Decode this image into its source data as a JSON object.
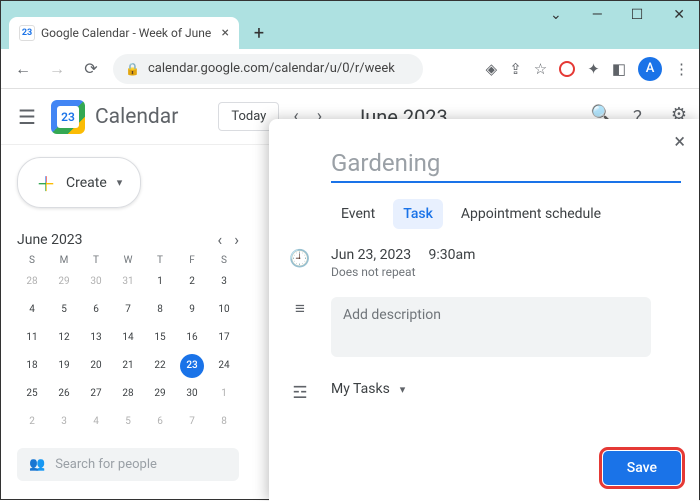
{
  "window": {
    "tab_title": "Google Calendar - Week of June",
    "tab_fav": "23"
  },
  "omnibox": {
    "url": "calendar.google.com/calendar/u/0/r/week"
  },
  "avatar": "A",
  "appbar": {
    "brand": "Calendar",
    "logo_day": "23",
    "today": "Today",
    "month": "June 2023"
  },
  "create": {
    "label": "Create"
  },
  "mini": {
    "month": "June 2023",
    "dow": [
      "S",
      "M",
      "T",
      "W",
      "T",
      "F",
      "S"
    ],
    "rows": [
      [
        28,
        29,
        30,
        31,
        1,
        2,
        3
      ],
      [
        4,
        5,
        6,
        7,
        8,
        9,
        10
      ],
      [
        11,
        12,
        13,
        14,
        15,
        16,
        17
      ],
      [
        18,
        19,
        20,
        21,
        22,
        23,
        24
      ],
      [
        25,
        26,
        27,
        28,
        29,
        30,
        1
      ],
      [
        2,
        3,
        4,
        5,
        6,
        7,
        8
      ]
    ],
    "selected": 23,
    "leading_muted": 4,
    "trailing_muted": 8
  },
  "search_people": {
    "placeholder": "Search for people"
  },
  "panel": {
    "title": "Gardening",
    "tabs": {
      "event": "Event",
      "task": "Task",
      "appt": "Appointment schedule"
    },
    "date": "Jun 23, 2023",
    "time": "9:30am",
    "repeat": "Does not repeat",
    "desc_placeholder": "Add description",
    "tasklist": "My Tasks",
    "save": "Save"
  }
}
